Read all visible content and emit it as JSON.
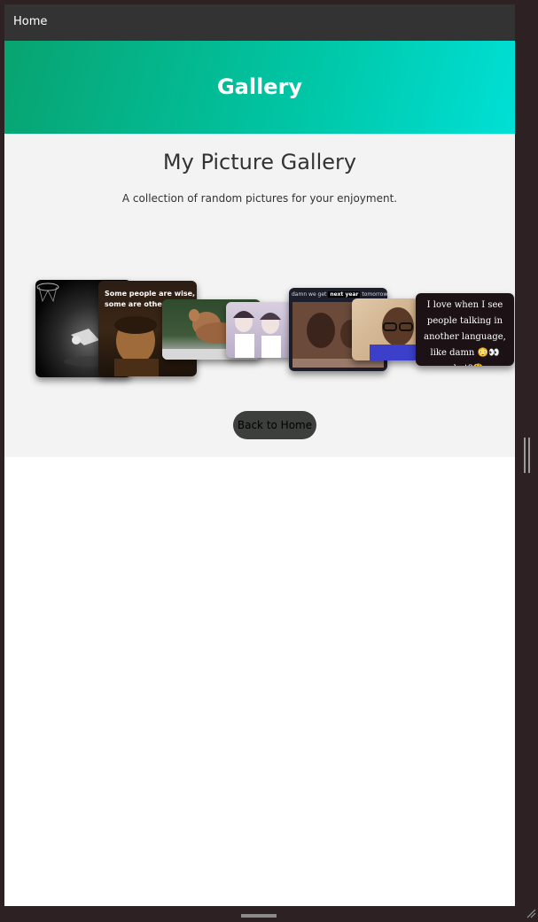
{
  "nav": {
    "home_label": "Home"
  },
  "banner": {
    "title": "Gallery"
  },
  "main": {
    "heading": "My Picture Gallery",
    "subtitle": "A collection of random pictures for your enjoyment.",
    "back_button_label": "Back to Home"
  },
  "gallery": {
    "images": [
      {
        "name": "basketball-photo"
      },
      {
        "name": "rembrandt-meme",
        "caption": "Some people are wise, some are otherw"
      },
      {
        "name": "squirrel-photo"
      },
      {
        "name": "anime-characters"
      },
      {
        "name": "next-year-meme",
        "caption_left": "damn we get",
        "caption_tag": "next year",
        "caption_right": "tomorrow"
      },
      {
        "name": "man-glasses-photo"
      },
      {
        "name": "language-meme",
        "caption": "I love when I see people talking in another language, like damn 😳👀 what?🤔"
      }
    ]
  },
  "colors": {
    "nav_bg": "#333333",
    "banner_start": "#08a370",
    "banner_end": "#00e0d6",
    "content_bg": "#f3f3f3",
    "button_bg": "#3d3f3d"
  }
}
